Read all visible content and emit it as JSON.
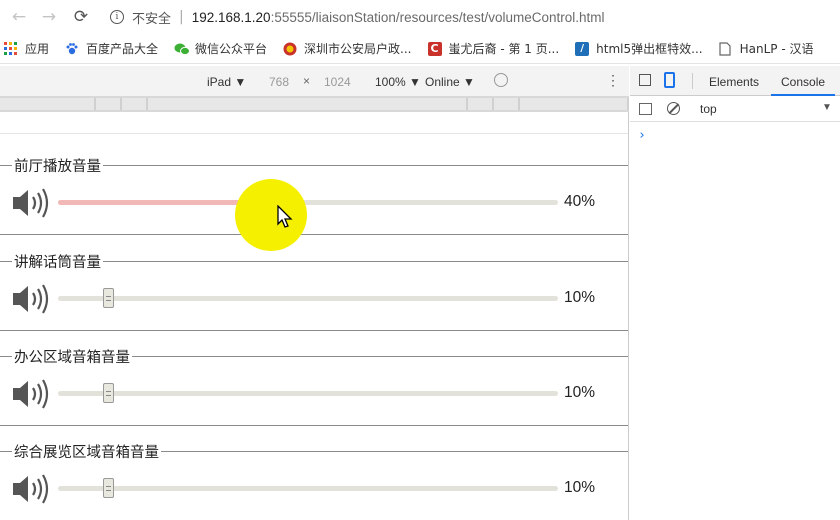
{
  "browser": {
    "back_glyph": "←",
    "forward_glyph": "→",
    "reload_glyph": "⟳",
    "info_glyph": "i",
    "security_label": "不安全",
    "url_host": "192.168.1.20",
    "url_rest": ":55555/liaisonStation/resources/test/volumeControl.html"
  },
  "bookmarks": [
    {
      "label": "应用",
      "icon": "apps-grid-icon"
    },
    {
      "label": "百度产品大全",
      "icon": "baidu-paw-icon",
      "color": "#2b6de0"
    },
    {
      "label": "微信公众平台",
      "icon": "wechat-icon",
      "color": "#3cb035"
    },
    {
      "label": "深圳市公安局户政...",
      "icon": "police-badge-icon",
      "color": "#c9322a"
    },
    {
      "label": "蚩尤后裔 - 第 1 页...",
      "icon": "csdn-c-icon",
      "color": "#c9322a"
    },
    {
      "label": "html5弹出框特效...",
      "icon": "site-favicon-icon",
      "color": "#1e6fb8"
    },
    {
      "label": "HanLP - 汉语",
      "icon": "document-icon",
      "color": "#666666"
    }
  ],
  "devtools_toolbar": {
    "device": "iPad ▼",
    "width": "768",
    "times": "×",
    "height": "1024",
    "zoom": "100% ▼",
    "network": "Online ▼",
    "more": "⋮"
  },
  "devtools_panel": {
    "tab_elements": "Elements",
    "tab_console": "Console",
    "context": "top",
    "context_arrow": "▼",
    "prompt": "›"
  },
  "colors": {
    "accent": "#1a73e8",
    "cursor_highlight": "#f5f000",
    "slider_fill": "#f2b8b8"
  },
  "volume_groups": [
    {
      "label": "前厅播放音量",
      "percent_label": "40%",
      "value": 0.4
    },
    {
      "label": "讲解话筒音量",
      "percent_label": "10%",
      "value": 0.1
    },
    {
      "label": "办公区域音箱音量",
      "percent_label": "10%",
      "value": 0.1
    },
    {
      "label": "综合展览区域音箱音量",
      "percent_label": "10%",
      "value": 0.1
    }
  ]
}
